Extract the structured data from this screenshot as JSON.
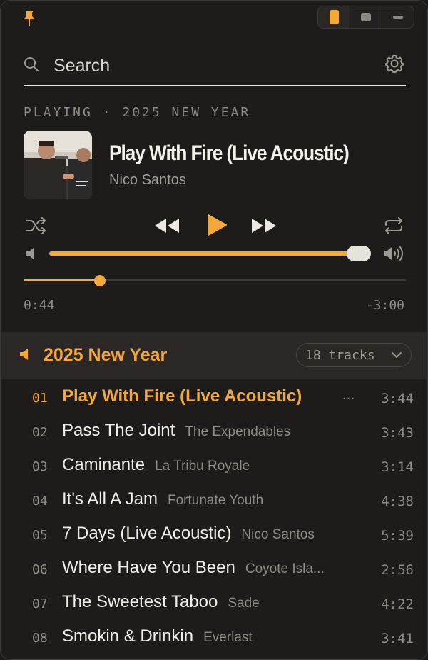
{
  "toolbar": {
    "pin_icon": "pin-icon",
    "view_modes": [
      "portrait-view",
      "square-view",
      "compact-view"
    ],
    "active_mode": "portrait-view"
  },
  "search": {
    "placeholder": "Search",
    "value": ""
  },
  "now_playing": {
    "label": "PLAYING · 2025 NEW YEAR",
    "title": "Play With Fire (Live Acoustic)",
    "artist": "Nico Santos",
    "elapsed": "0:44",
    "remaining": "-3:00",
    "progress_fraction": 0.2,
    "volume_fraction": 0.97
  },
  "playlist": {
    "name": "2025 New Year",
    "track_count_label": "18 tracks",
    "tracks": [
      {
        "num": "01",
        "title": "Play With Fire (Live Acoustic)",
        "artist": "",
        "duration": "3:44",
        "active": true
      },
      {
        "num": "02",
        "title": "Pass The Joint",
        "artist": "The Expendables",
        "duration": "3:43"
      },
      {
        "num": "03",
        "title": "Caminante",
        "artist": "La Tribu Royale",
        "duration": "3:14"
      },
      {
        "num": "04",
        "title": "It's All A Jam",
        "artist": "Fortunate Youth",
        "duration": "4:38"
      },
      {
        "num": "05",
        "title": "7 Days (Live Acoustic)",
        "artist": "Nico Santos",
        "duration": "5:39"
      },
      {
        "num": "06",
        "title": "Where Have You Been",
        "artist": "Coyote Isla...",
        "duration": "2:56"
      },
      {
        "num": "07",
        "title": "The Sweetest Taboo",
        "artist": "Sade",
        "duration": "4:22"
      },
      {
        "num": "08",
        "title": "Smokin & Drinkin",
        "artist": "Everlast",
        "duration": "3:41"
      }
    ]
  },
  "colors": {
    "accent": "#f5a83a",
    "background": "#1e1c1a",
    "muted": "#8f8a83"
  }
}
